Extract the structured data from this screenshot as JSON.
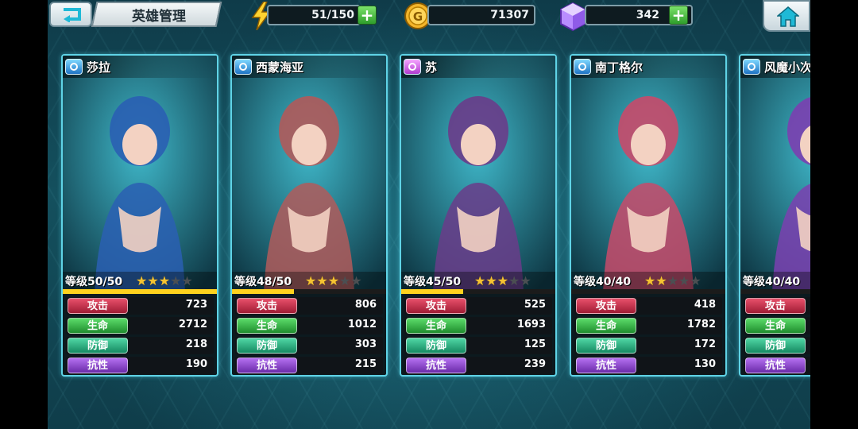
{
  "header": {
    "back_icon": "back-arrow-icon",
    "title": "英雄管理",
    "energy": {
      "icon": "lightning-icon",
      "value": "51/150"
    },
    "gold": {
      "icon": "gold-coin-icon",
      "value": "71307"
    },
    "gems": {
      "icon": "crystal-gem-icon",
      "value": "342"
    },
    "home_icon": "home-icon"
  },
  "stat_labels": {
    "attack": "攻击",
    "hp": "生命",
    "defense": "防御",
    "resist": "抗性"
  },
  "heroes": [
    {
      "name": "莎拉",
      "class_icon": "shield-class-icon",
      "level": "等级50/50",
      "stars": 3,
      "max_stars": 5,
      "xp_fraction": 1.0,
      "stats": {
        "attack": "723",
        "hp": "2712",
        "defense": "218",
        "resist": "190"
      },
      "theme": "#2a5fb3"
    },
    {
      "name": "西蒙海亚",
      "class_icon": "shield-class-icon",
      "level": "等级48/50",
      "stars": 3,
      "max_stars": 5,
      "xp_fraction": 0.4,
      "stats": {
        "attack": "806",
        "hp": "1012",
        "defense": "303",
        "resist": "215"
      },
      "theme": "#b05a5a"
    },
    {
      "name": "苏",
      "class_icon": "mage-class-icon",
      "level": "等级45/50",
      "stars": 3,
      "max_stars": 5,
      "xp_fraction": 0.4,
      "stats": {
        "attack": "525",
        "hp": "1693",
        "defense": "125",
        "resist": "239"
      },
      "theme": "#6a3c8a"
    },
    {
      "name": "南丁格尔",
      "class_icon": "shield-class-icon",
      "level": "等级40/40",
      "stars": 2,
      "max_stars": 5,
      "xp_fraction": 0.0,
      "stats": {
        "attack": "418",
        "hp": "1782",
        "defense": "172",
        "resist": "130"
      },
      "theme": "#c84a6a"
    },
    {
      "name": "风魔小次",
      "class_icon": "shield-class-icon",
      "level": "等级40/40",
      "stars": 0,
      "max_stars": 5,
      "xp_fraction": 0.0,
      "stats": {
        "attack": "",
        "hp": "",
        "defense": "",
        "resist": ""
      },
      "theme": "#7b3fb0"
    }
  ]
}
